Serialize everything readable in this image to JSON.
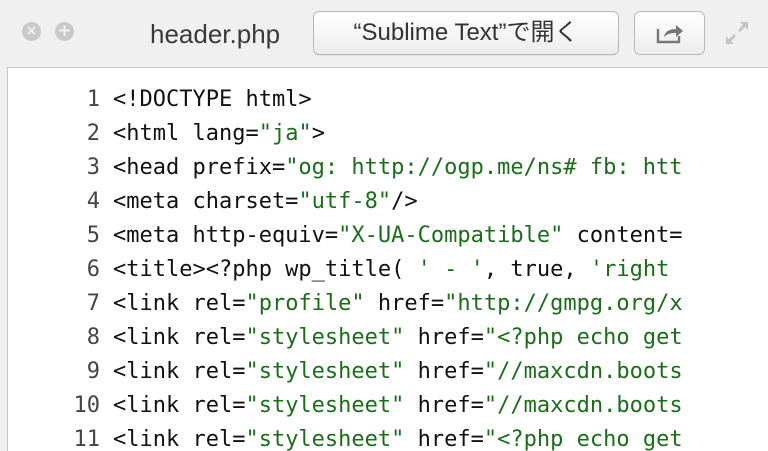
{
  "toolbar": {
    "close_glyph": "×",
    "add_glyph": "+",
    "filename": "header.php",
    "open_button_label": "“Sublime Text”で開く"
  },
  "icons": {
    "close": "close-icon",
    "add": "plus-icon",
    "share": "share-icon",
    "expand": "expand-icon"
  },
  "colors": {
    "string": "#1a6e1a",
    "text": "#111111",
    "line_number": "#444444"
  },
  "code_lines": [
    {
      "n": "1",
      "tokens": [
        {
          "t": "<!DOCTYPE html>",
          "c": ""
        }
      ]
    },
    {
      "n": "2",
      "tokens": [
        {
          "t": "<html lang=",
          "c": ""
        },
        {
          "t": "\"ja\"",
          "c": "str"
        },
        {
          "t": ">",
          "c": ""
        }
      ]
    },
    {
      "n": "3",
      "tokens": [
        {
          "t": "<head prefix=",
          "c": ""
        },
        {
          "t": "\"og: http://ogp.me/ns# fb: htt",
          "c": "str"
        }
      ]
    },
    {
      "n": "4",
      "tokens": [
        {
          "t": "<meta charset=",
          "c": ""
        },
        {
          "t": "\"utf-8\"",
          "c": "str"
        },
        {
          "t": "/>",
          "c": ""
        }
      ]
    },
    {
      "n": "5",
      "tokens": [
        {
          "t": "<meta http-equiv=",
          "c": ""
        },
        {
          "t": "\"X-UA-Compatible\"",
          "c": "str"
        },
        {
          "t": " content=",
          "c": ""
        }
      ]
    },
    {
      "n": "6",
      "tokens": [
        {
          "t": "<title><?php wp_title( ",
          "c": ""
        },
        {
          "t": "' - '",
          "c": "str"
        },
        {
          "t": ", true, ",
          "c": ""
        },
        {
          "t": "'right",
          "c": "str"
        }
      ]
    },
    {
      "n": "7",
      "tokens": [
        {
          "t": "<link rel=",
          "c": ""
        },
        {
          "t": "\"profile\"",
          "c": "str"
        },
        {
          "t": " href=",
          "c": ""
        },
        {
          "t": "\"http://gmpg.org/x",
          "c": "str"
        }
      ]
    },
    {
      "n": "8",
      "tokens": [
        {
          "t": "<link rel=",
          "c": ""
        },
        {
          "t": "\"stylesheet\"",
          "c": "str"
        },
        {
          "t": " href=",
          "c": ""
        },
        {
          "t": "\"<?php echo get",
          "c": "str"
        }
      ]
    },
    {
      "n": "9",
      "tokens": [
        {
          "t": "<link rel=",
          "c": ""
        },
        {
          "t": "\"stylesheet\"",
          "c": "str"
        },
        {
          "t": " href=",
          "c": ""
        },
        {
          "t": "\"//maxcdn.boots",
          "c": "str"
        }
      ]
    },
    {
      "n": "10",
      "tokens": [
        {
          "t": "<link rel=",
          "c": ""
        },
        {
          "t": "\"stylesheet\"",
          "c": "str"
        },
        {
          "t": " href=",
          "c": ""
        },
        {
          "t": "\"//maxcdn.boots",
          "c": "str"
        }
      ]
    },
    {
      "n": "11",
      "tokens": [
        {
          "t": "<link rel=",
          "c": ""
        },
        {
          "t": "\"stylesheet\"",
          "c": "str"
        },
        {
          "t": " href=",
          "c": ""
        },
        {
          "t": "\"<?php echo get",
          "c": "str"
        }
      ]
    }
  ]
}
